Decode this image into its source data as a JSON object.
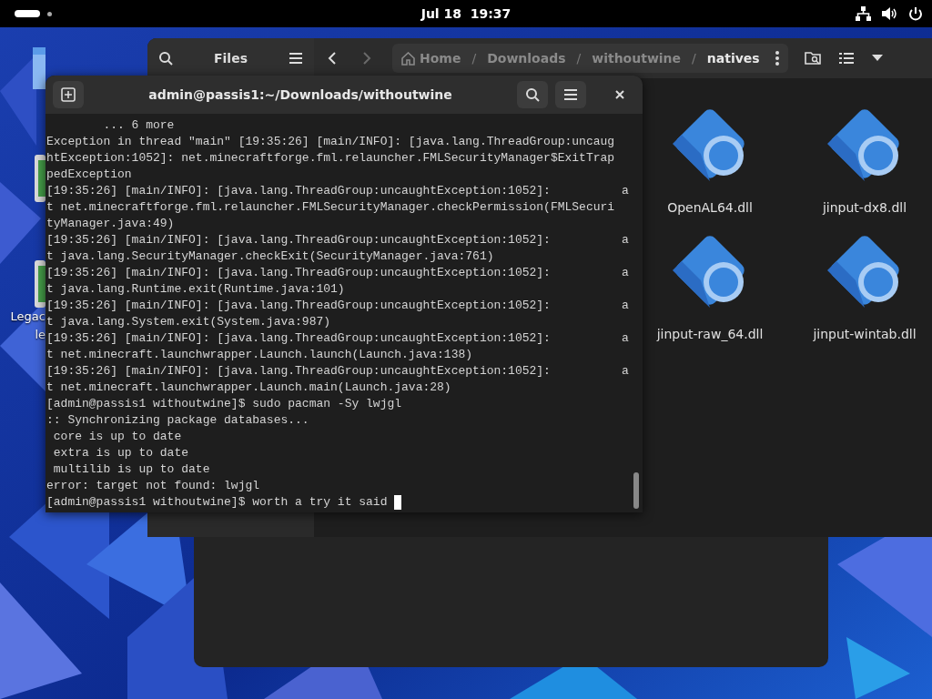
{
  "top_bar": {
    "clock": "Jul 18  19:37"
  },
  "desktop_icons": [
    {
      "kind": "folder"
    },
    {
      "kind": "app"
    },
    {
      "kind": "app",
      "labels": [
        "Legac",
        "le"
      ]
    }
  ],
  "files_window": {
    "title": "Files",
    "nav": [
      {
        "kind": "back",
        "disabled": false
      },
      {
        "kind": "forward",
        "disabled": true
      }
    ],
    "path": [
      {
        "label": "Home",
        "selected": false
      },
      {
        "label": "Downloads",
        "separator": "/",
        "selected": false
      },
      {
        "label": "withoutwine",
        "separator": "/",
        "selected": false
      },
      {
        "label": "natives",
        "separator": "/",
        "selected": true
      }
    ],
    "items": [
      {
        "name": "OpenAL64.dll"
      },
      {
        "name": "jinput-dx8.dll"
      },
      {
        "name": "jinput-raw_64.dll"
      },
      {
        "name": "jinput-wintab.dll"
      }
    ]
  },
  "terminal": {
    "title": "admin@passis1:~/Downloads/withoutwine",
    "lines": [
      "        ... 6 more",
      "Exception in thread \"main\" [19:35:26] [main/INFO]: [java.lang.ThreadGroup:uncaug",
      "htException:1052]: net.minecraftforge.fml.relauncher.FMLSecurityManager$ExitTrap",
      "pedException",
      "[19:35:26] [main/INFO]: [java.lang.ThreadGroup:uncaughtException:1052]:          a",
      "t net.minecraftforge.fml.relauncher.FMLSecurityManager.checkPermission(FMLSecuri",
      "tyManager.java:49)",
      "[19:35:26] [main/INFO]: [java.lang.ThreadGroup:uncaughtException:1052]:          a",
      "t java.lang.SecurityManager.checkExit(SecurityManager.java:761)",
      "[19:35:26] [main/INFO]: [java.lang.ThreadGroup:uncaughtException:1052]:          a",
      "t java.lang.Runtime.exit(Runtime.java:101)",
      "[19:35:26] [main/INFO]: [java.lang.ThreadGroup:uncaughtException:1052]:          a",
      "t java.lang.System.exit(System.java:987)",
      "[19:35:26] [main/INFO]: [java.lang.ThreadGroup:uncaughtException:1052]:          a",
      "t net.minecraft.launchwrapper.Launch.launch(Launch.java:138)",
      "[19:35:26] [main/INFO]: [java.lang.ThreadGroup:uncaughtException:1052]:          a",
      "t net.minecraft.launchwrapper.Launch.main(Launch.java:28)",
      "[admin@passis1 withoutwine]$ sudo pacman -Sy lwjgl",
      ":: Synchronizing package databases...",
      " core is up to date",
      " extra is up to date",
      " multilib is up to date",
      "error: target not found: lwjgl",
      "[admin@passis1 withoutwine]$ worth a try it said "
    ]
  }
}
